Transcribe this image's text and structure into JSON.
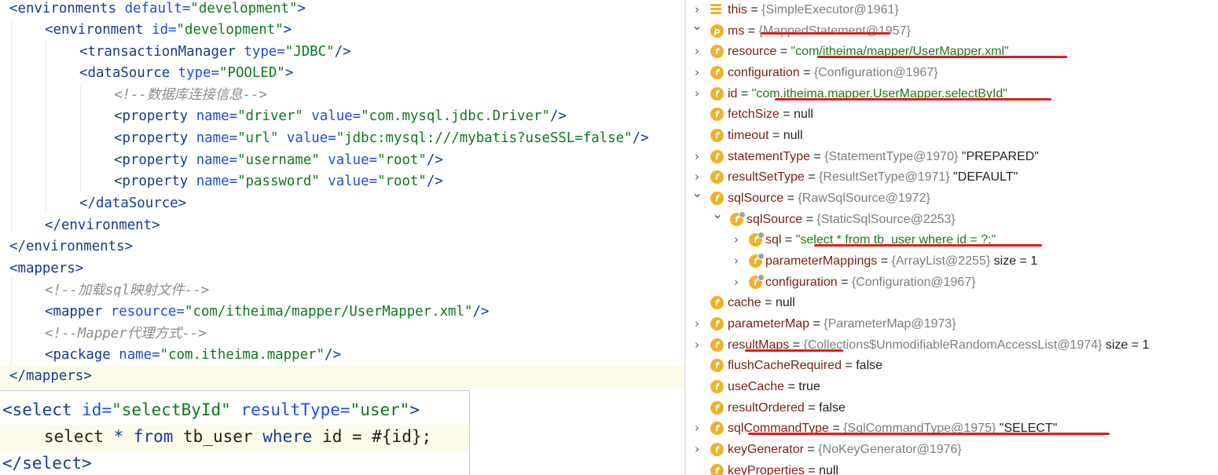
{
  "xml_editor": {
    "lines": [
      [
        [
          "tag",
          "<environments "
        ],
        [
          "attr",
          "default="
        ],
        [
          "val",
          "\"development\""
        ],
        [
          "tag",
          ">"
        ]
      ],
      [
        [
          "tag",
          "<environment "
        ],
        [
          "attr",
          "id="
        ],
        [
          "val",
          "\"development\""
        ],
        [
          "tag",
          ">"
        ]
      ],
      [
        [
          "tag",
          "<transactionManager "
        ],
        [
          "attr",
          "type="
        ],
        [
          "val",
          "\"JDBC\""
        ],
        [
          "tag",
          "/>"
        ]
      ],
      [
        [
          "tag",
          "<dataSource "
        ],
        [
          "attr",
          "type="
        ],
        [
          "val",
          "\"POOLED\""
        ],
        [
          "tag",
          ">"
        ]
      ],
      [
        [
          "cmt",
          "<!--数据库连接信息-->"
        ]
      ],
      [
        [
          "tag",
          "<property "
        ],
        [
          "attr",
          "name="
        ],
        [
          "val",
          "\"driver\" "
        ],
        [
          "attr",
          "value="
        ],
        [
          "val",
          "\"com.mysql.jdbc.Driver\""
        ],
        [
          "tag",
          "/>"
        ]
      ],
      [
        [
          "tag",
          "<property "
        ],
        [
          "attr",
          "name="
        ],
        [
          "val",
          "\"url\" "
        ],
        [
          "attr",
          "value="
        ],
        [
          "val",
          "\"jdbc:mysql:///mybatis?useSSL=false\""
        ],
        [
          "tag",
          "/>"
        ]
      ],
      [
        [
          "tag",
          "<property "
        ],
        [
          "attr",
          "name="
        ],
        [
          "val",
          "\"username\" "
        ],
        [
          "attr",
          "value="
        ],
        [
          "val",
          "\"root\""
        ],
        [
          "tag",
          "/>"
        ]
      ],
      [
        [
          "tag",
          "<property "
        ],
        [
          "attr",
          "name="
        ],
        [
          "val",
          "\"password\" "
        ],
        [
          "attr",
          "value="
        ],
        [
          "val",
          "\"root\""
        ],
        [
          "tag",
          "/>"
        ]
      ],
      [
        [
          "tag",
          "</dataSource>"
        ]
      ],
      [
        [
          "tag",
          "</environment>"
        ]
      ],
      [
        [
          "tag",
          "</environments>"
        ]
      ],
      [
        [
          "tag",
          "<mappers>"
        ]
      ],
      [
        [
          "cmt",
          "<!--加载sql映射文件-->"
        ]
      ],
      [
        [
          "tag",
          "<mapper "
        ],
        [
          "attr",
          "resource="
        ],
        [
          "val",
          "\"com/itheima/mapper/UserMapper.xml\""
        ],
        [
          "tag",
          "/>"
        ]
      ],
      [
        [
          "cmt",
          "<!--Mapper代理方式-->"
        ]
      ],
      [
        [
          "tag",
          "<package "
        ],
        [
          "attr",
          "name="
        ],
        [
          "val",
          "\"com.itheima.mapper\""
        ],
        [
          "tag",
          "/>"
        ]
      ],
      [
        [
          "tag",
          "</mappers>"
        ]
      ]
    ]
  },
  "sql_editor": {
    "lines": [
      [
        [
          "tag",
          "<select "
        ],
        [
          "attr",
          "id="
        ],
        [
          "val",
          "\"selectById\" "
        ],
        [
          "attr",
          "resultType="
        ],
        [
          "val",
          "\"user\""
        ],
        [
          "tag",
          ">"
        ]
      ],
      [
        [
          "pun",
          "select "
        ],
        [
          "kw",
          "* from "
        ],
        [
          "pun",
          "tb_user "
        ],
        [
          "kw",
          "where "
        ],
        [
          "pun",
          "id = #{id};"
        ]
      ],
      [
        [
          "tag",
          "</select>"
        ]
      ]
    ]
  },
  "debugger": {
    "rows": [
      {
        "chev": "right",
        "icon": "lines",
        "name": "this",
        "eq": " = ",
        "ref": "{SimpleExecutor@1961}"
      },
      {
        "chev": "down",
        "icon": "p",
        "name": "ms",
        "eq": " = ",
        "ref": "{MappedStatement@1957}"
      },
      {
        "chev": "right",
        "icon": "f",
        "name": "resource",
        "eq": " = ",
        "str": "\"com/itheima/mapper/UserMapper.xml\""
      },
      {
        "chev": "right",
        "icon": "f",
        "name": "configuration",
        "eq": " = ",
        "ref": "{Configuration@1967}"
      },
      {
        "chev": "right",
        "icon": "f",
        "name": "id",
        "eq": " = ",
        "str": "\"com.itheima.mapper.UserMapper.selectById\""
      },
      {
        "chev": "",
        "icon": "f",
        "name": "fetchSize",
        "eq": " = ",
        "plain": "null"
      },
      {
        "chev": "",
        "icon": "f",
        "name": "timeout",
        "eq": " = ",
        "plain": "null"
      },
      {
        "chev": "right",
        "icon": "f",
        "name": "statementType",
        "eq": " = ",
        "ref": "{StatementType@1970}",
        "plain": " \"PREPARED\""
      },
      {
        "chev": "right",
        "icon": "f",
        "name": "resultSetType",
        "eq": " = ",
        "ref": "{ResultSetType@1971}",
        "plain": " \"DEFAULT\""
      },
      {
        "chev": "down",
        "icon": "f",
        "name": "sqlSource",
        "eq": " = ",
        "ref": "{RawSqlSource@1972}"
      },
      {
        "chev": "down",
        "icon": "fs",
        "name": "sqlSource",
        "eq": " = ",
        "ref": "{StaticSqlSource@2253}"
      },
      {
        "chev": "right",
        "icon": "fs",
        "name": "sql",
        "eq": " = ",
        "str": "\"select * from tb_user where id = ?;\""
      },
      {
        "chev": "right",
        "icon": "fs",
        "name": "parameterMappings",
        "eq": " = ",
        "ref": "{ArrayList@2255}",
        "plain": "  size = 1"
      },
      {
        "chev": "right",
        "icon": "fs",
        "name": "configuration",
        "eq": " = ",
        "ref": "{Configuration@1967}"
      },
      {
        "chev": "",
        "icon": "f",
        "name": "cache",
        "eq": " = ",
        "plain": "null"
      },
      {
        "chev": "right",
        "icon": "f",
        "name": "parameterMap",
        "eq": " = ",
        "ref": "{ParameterMap@1973}"
      },
      {
        "chev": "right",
        "icon": "f",
        "name": "resultMaps",
        "eq": " = ",
        "ref": "{Collections$UnmodifiableRandomAccessList@1974}",
        "plain": "  size = 1"
      },
      {
        "chev": "",
        "icon": "f",
        "name": "flushCacheRequired",
        "eq": " = ",
        "plain": "false"
      },
      {
        "chev": "",
        "icon": "f",
        "name": "useCache",
        "eq": " = ",
        "plain": "true"
      },
      {
        "chev": "",
        "icon": "f",
        "name": "resultOrdered",
        "eq": " = ",
        "plain": "false"
      },
      {
        "chev": "right",
        "icon": "f",
        "name": "sqlCommandType",
        "eq": " = ",
        "ref": "{SqlCommandType@1975}",
        "plain": " \"SELECT\""
      },
      {
        "chev": "right",
        "icon": "f",
        "name": "keyGenerator",
        "eq": " = ",
        "ref": "{NoKeyGenerator@1976}"
      },
      {
        "chev": "",
        "icon": "f",
        "name": "keyProperties",
        "eq": " = ",
        "plain": "null"
      }
    ]
  },
  "colors": {
    "tag": "#0f3d91",
    "attribute": "#1c4fd6",
    "string": "#0a7a1b",
    "comment": "#8c8c8c",
    "field_name": "#7a1f10",
    "field_icon": "#f0b12a",
    "annotation_underline": "#e11b1b",
    "caret_line": "#fcfae8"
  }
}
